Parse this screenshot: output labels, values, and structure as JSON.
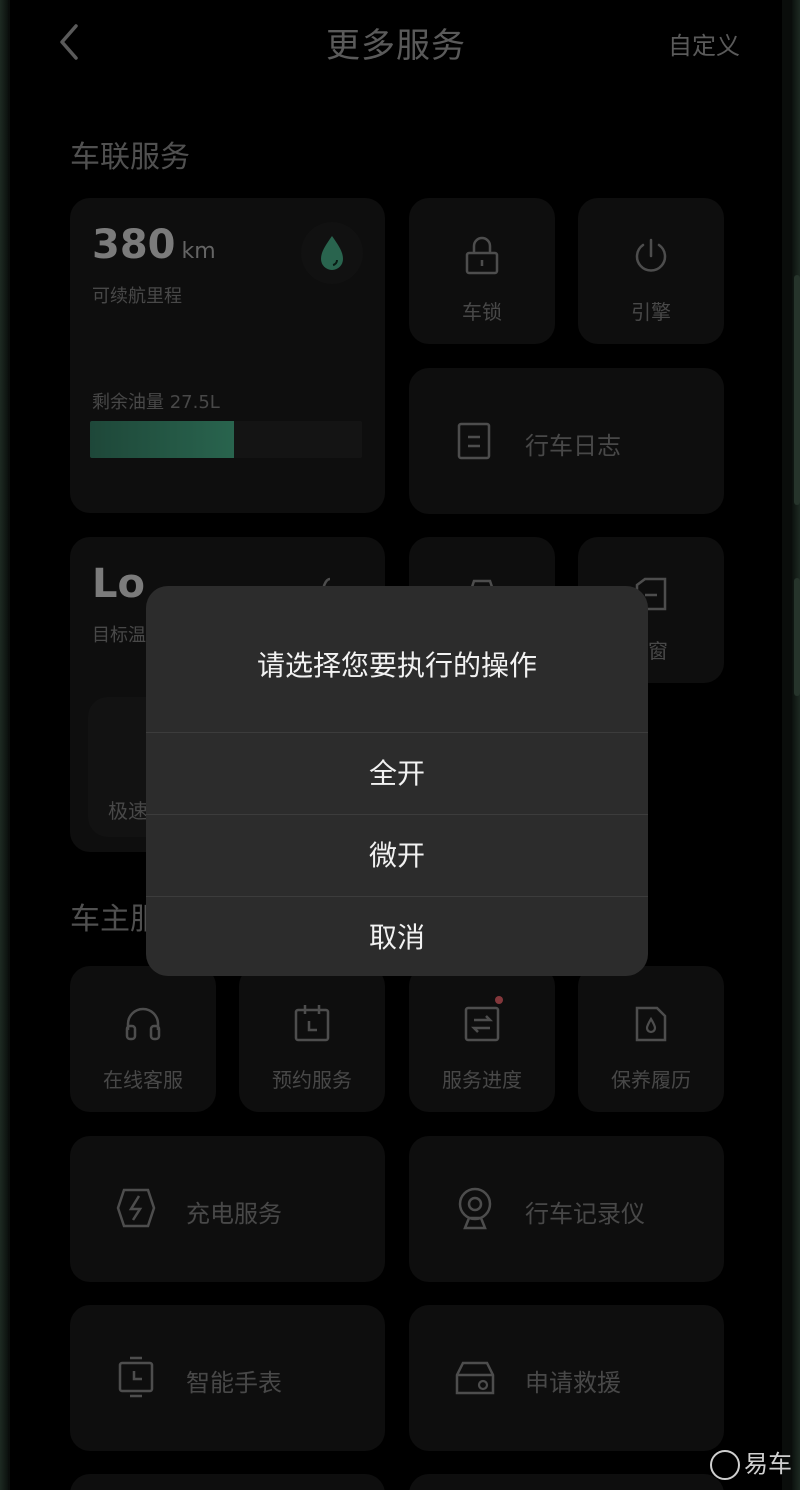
{
  "header": {
    "title": "更多服务",
    "custom_label": "自定义"
  },
  "sections": {
    "vehicle_services": "车联服务",
    "owner_services_partial": "车主服"
  },
  "fuel_card": {
    "range_value": "380",
    "range_unit": "km",
    "range_label": "可续航里程",
    "fuel_label": "剩余油量 27.5L",
    "fuel_level_percent": 53
  },
  "tiles": {
    "lock": "车锁",
    "engine": "引擎",
    "drive_log": "行车日志",
    "window_partial": "窗"
  },
  "climate_card": {
    "value": "Lo",
    "label_partial": "目标温",
    "quick_partial": "极速"
  },
  "owner_tiles": [
    {
      "label": "在线客服",
      "icon": "headset-icon"
    },
    {
      "label": "预约服务",
      "icon": "calendar-icon"
    },
    {
      "label": "服务进度",
      "icon": "progress-icon"
    },
    {
      "label": "保养履历",
      "icon": "maintenance-icon"
    }
  ],
  "wide_tiles": [
    {
      "label": "充电服务",
      "icon": "lightning-icon"
    },
    {
      "label": "行车记录仪",
      "icon": "dashcam-icon"
    },
    {
      "label": "智能手表",
      "icon": "watch-icon"
    },
    {
      "label": "申请救援",
      "icon": "rescue-car-icon"
    }
  ],
  "dialog": {
    "title": "请选择您要执行的操作",
    "options": [
      "全开",
      "微开",
      "取消"
    ]
  },
  "watermark": "易车",
  "colors": {
    "accent_green": "#3f9a78",
    "badge_red": "#c9555b"
  }
}
